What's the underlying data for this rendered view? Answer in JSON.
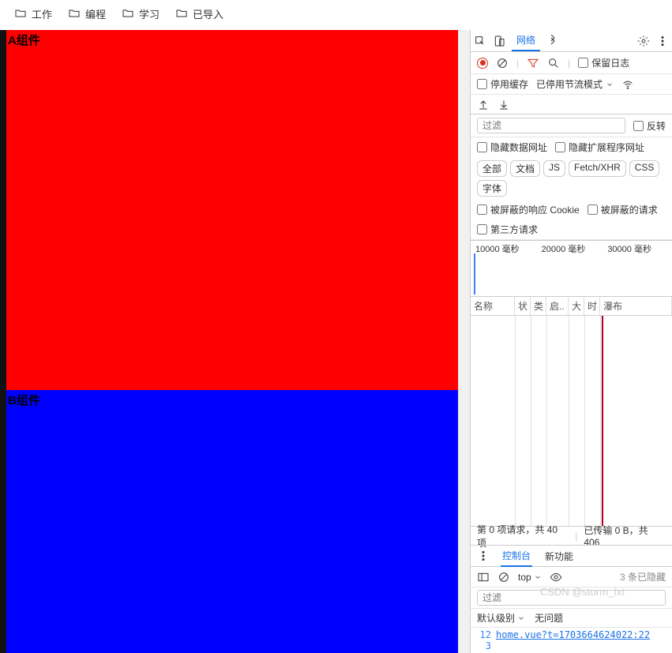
{
  "bookmarks": [
    "工作",
    "编程",
    "学习",
    "已导入"
  ],
  "page": {
    "compA": "A组件",
    "compB": "B组件"
  },
  "devtools": {
    "tabs": {
      "network": "网络"
    },
    "toolbar": {
      "preserve_log": "保留日志",
      "disable_cache": "停用缓存",
      "throttle": "已停用节流模式"
    },
    "filter": {
      "placeholder": "过滤",
      "invert": "反转",
      "hide_data": "隐藏数据网址",
      "hide_ext": "隐藏扩展程序网址",
      "blocked_cookie": "被屏蔽的响应 Cookie",
      "blocked_req": "被屏蔽的请求",
      "third_party": "第三方请求"
    },
    "types": [
      "全部",
      "文档",
      "JS",
      "Fetch/XHR",
      "CSS",
      "字体"
    ],
    "timeline": [
      "10000 毫秒",
      "20000 毫秒",
      "30000 毫秒"
    ],
    "cols": {
      "name": "名称",
      "c1": "状",
      "c2": "类",
      "c3": "启..",
      "c4": "大",
      "c5": "时",
      "waterfall": "瀑布"
    },
    "status": {
      "requests": "第 0 项请求，共 40 项",
      "transferred": "已传输 0 B，共 406 "
    },
    "console": {
      "tab": "控制台",
      "whatsnew": "新功能",
      "top": "top",
      "hidden": "3 条已隐藏",
      "filter_ph": "过滤",
      "level": "默认级别",
      "issues": "无问题",
      "line1": "12",
      "line2": "3",
      "msg": "home.vue?t=1703664624022:22"
    }
  },
  "watermark": "CSDN @storm_fxt"
}
